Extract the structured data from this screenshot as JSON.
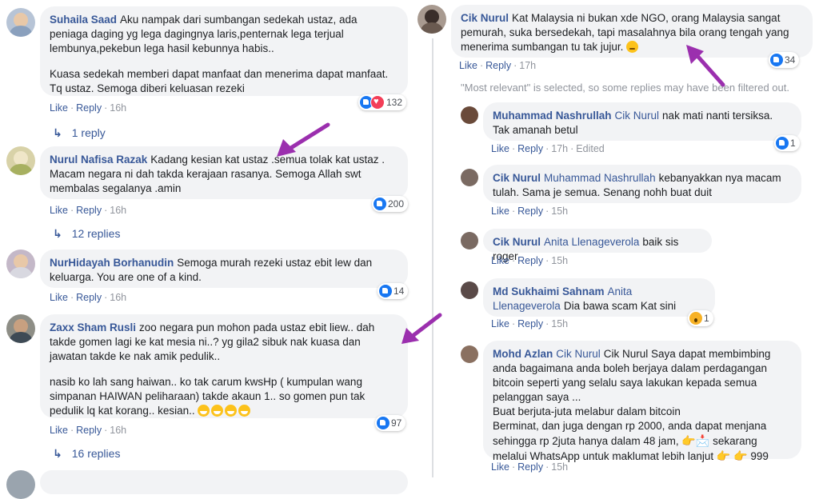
{
  "actions": {
    "like": "Like",
    "reply": "Reply",
    "sep": "·",
    "edited": "Edited"
  },
  "left": [
    {
      "name": "Suhaila Saad",
      "text": "Aku nampak dari sumbangan sedekah ustaz, ada peniaga daging yg lega dagingnya laris,penternak lega terjual lembunya,pekebun lega hasil kebunnya habis..",
      "text2": "Kuasa sedekah memberi dapat manfaat dan menerima dapat manfaat. Tq ustaz. Semoga diberi keluasan rezeki",
      "time": "16h",
      "reactions": "132",
      "replies": "1 reply"
    },
    {
      "name": "Nurul Nafisa Razak",
      "text": "Kadang kesian kat ustaz .semua tolak kat ustaz . Macam negara ni dah takda kerajaan rasanya. Semoga Allah swt membalas segalanya .amin",
      "time": "16h",
      "reactions": "200",
      "replies": "12 replies"
    },
    {
      "name": "NurHidayah Borhanudin",
      "text": "Semoga murah rezeki ustaz ebit lew dan keluarga. You are one of a kind.",
      "time": "16h",
      "reactions": "14"
    },
    {
      "name": "Zaxx Sham Rusli",
      "text": "zoo negara pun mohon pada ustaz ebit liew.. dah takde gomen lagi ke kat mesia ni..? yg gila2 sibuk nak kuasa dan jawatan takde ke nak amik pedulik..",
      "text2": "nasib ko lah sang haiwan.. ko tak carum kwsHp ( kumpulan wang simpanan HAIWAN peliharaan) takde akaun 1.. so gomen pun tak pedulik lq kat korang.. kesian..",
      "time": "16h",
      "reactions": "97",
      "replies": "16 replies"
    }
  ],
  "right": {
    "main": {
      "name": "Cik Nurul",
      "text": "Kat Malaysia ni bukan xde NGO, orang Malaysia sangat pemurah, suka bersedekah, tapi masalahnya bila orang tengah yang menerima sumbangan tu tak jujur.",
      "time": "17h",
      "reactions": "34"
    },
    "filter_note": "\"Most relevant\" is selected, so some replies may have been filtered out.",
    "replies": [
      {
        "name": "Muhammad Nashrullah",
        "mention": "Cik Nurul",
        "text": "nak mati nanti tersiksa. Tak amanah betul",
        "time": "17h",
        "reactions": "1"
      },
      {
        "name": "Cik Nurul",
        "mention": "Muhammad Nashrullah",
        "text": "kebanyakkan nya macam tulah. Sama je semua. Senang nohh buat duit",
        "time": "15h"
      },
      {
        "name": "Cik Nurul",
        "mention": "Anita Llenageverola",
        "text": "baik sis roger",
        "time": "15h"
      },
      {
        "name": "Md Sukhaimi Sahnam",
        "mention": "Anita Llenageverola",
        "text": "Dia bawa scam Kat sini",
        "time": "15h",
        "reactions": "1"
      },
      {
        "name": "Mohd Azlan",
        "mention": "Cik Nurul",
        "text": "Cik Nurul Saya dapat membimbing anda bagaimana anda boleh berjaya dalam perdagangan bitcoin seperti yang selalu saya lakukan kepada semua pelanggan saya ...",
        "line2": "Buat berjuta-juta melabur dalam bitcoin",
        "line3a": "Berminat, dan juga dengan rp 2000, anda dapat menjana sehingga rp 2juta hanya dalam 48 jam,",
        "line3b": "sekarang melalui WhatsApp untuk maklumat lebih lanjut",
        "line3c": "999",
        "time": "15h"
      }
    ]
  },
  "colors": {
    "link": "#385898",
    "bubble": "#f2f3f5",
    "arrow": "#9b2fae",
    "like": "#1877f2"
  }
}
